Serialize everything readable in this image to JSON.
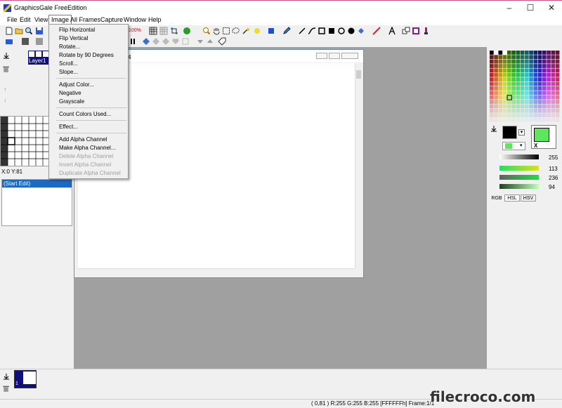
{
  "window": {
    "title": "GraphicsGale FreeEdition",
    "controls": {
      "minimize": "–",
      "maximize": "☐",
      "close": "✕"
    }
  },
  "menubar": {
    "items": [
      "File",
      "Edit",
      "View",
      "Image",
      "All Frames",
      "Capture",
      "Window",
      "Help"
    ],
    "active": "Image"
  },
  "image_menu": {
    "items": [
      {
        "label": "Flip Horizontal",
        "enabled": true
      },
      {
        "label": "Flip Vertical",
        "enabled": true
      },
      {
        "label": "Rotate...",
        "enabled": true
      },
      {
        "label": "Rotate by 90 Degrees",
        "enabled": true
      },
      {
        "label": "Scroll...",
        "enabled": true
      },
      {
        "label": "Slope...",
        "enabled": true
      },
      {
        "label": "Adjust Color...",
        "enabled": true
      },
      {
        "label": "Negative",
        "enabled": true
      },
      {
        "label": "Grayscale",
        "enabled": true
      },
      {
        "label": "Count Colors Used...",
        "enabled": true
      },
      {
        "label": "Effect...",
        "enabled": true
      },
      {
        "label": "Add Alpha Channel",
        "enabled": true
      },
      {
        "label": "Make Alpha Channel...",
        "enabled": true
      },
      {
        "label": "Delete Alpha Channel",
        "enabled": false
      },
      {
        "label": "Invert Alpha Channel",
        "enabled": false
      },
      {
        "label": "Duplicate Alpha Channel",
        "enabled": false
      }
    ]
  },
  "toolbar": {
    "zoom_label": "100%"
  },
  "layers": {
    "layer_name": "Layer1"
  },
  "cursor": {
    "coords": "X:0 Y:81"
  },
  "history": {
    "items": [
      "(Start Edit)"
    ]
  },
  "document": {
    "title_fragment": "4"
  },
  "color_panel": {
    "slider_values": [
      "255",
      "113",
      "236",
      "94"
    ],
    "tabs": [
      "RGB",
      "HSL",
      "HSV"
    ],
    "active_tab": "HSL",
    "swap_label": "X",
    "primary_color": "#000000",
    "secondary_color": "#5ee65e"
  },
  "frames": {
    "frame_index": "1"
  },
  "status": {
    "text": "( 0,81 ) R:255 G:255 B:255   [FFFFFFh]  Frame:1/1"
  },
  "watermark": {
    "text": "filecroco.com"
  },
  "colors": {
    "selection_blue": "#10107a",
    "history_highlight": "#1a6ac2",
    "workspace_gray": "#a0a0a0"
  }
}
